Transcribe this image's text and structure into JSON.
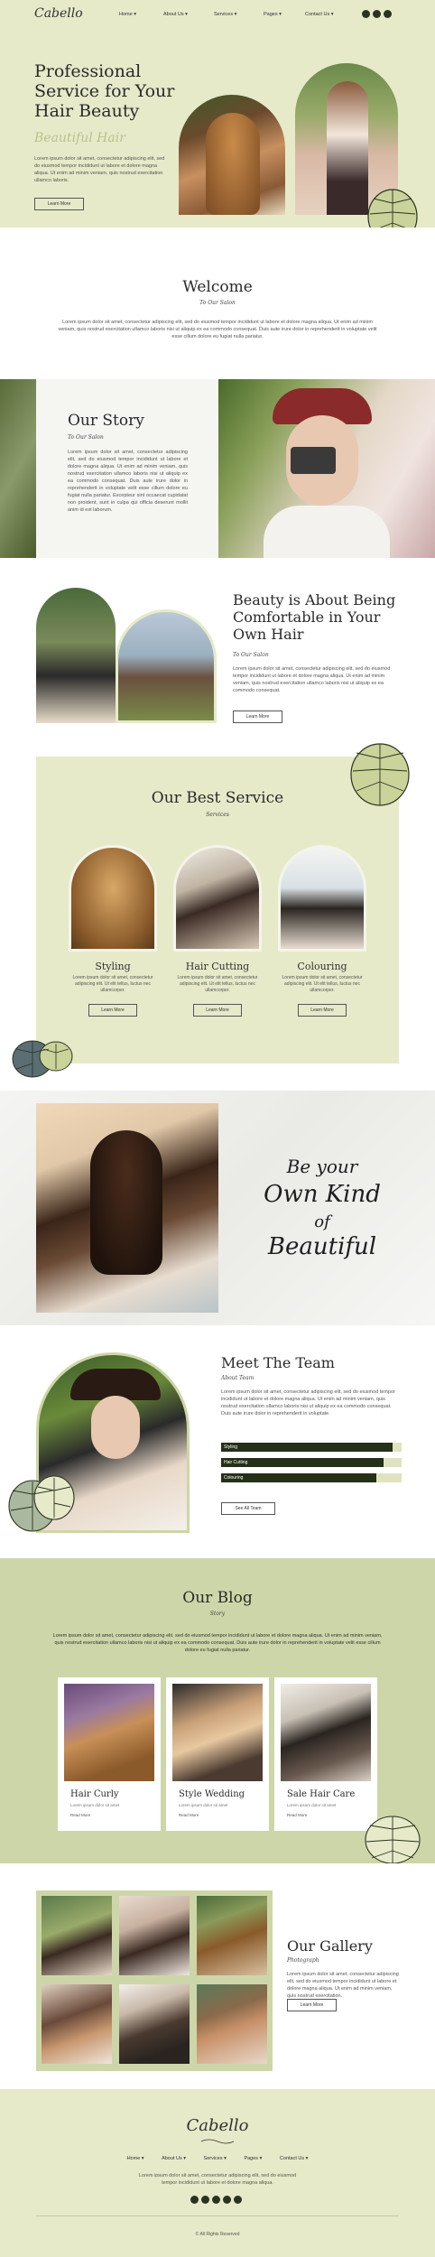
{
  "header": {
    "logo": "Cabello",
    "nav": [
      "Home",
      "About Us",
      "Services",
      "Pages",
      "Contact Us"
    ]
  },
  "hero": {
    "title_line1": "Professional",
    "title_line2": "Service for Your",
    "title_line3": "Hair Beauty",
    "subtitle": "Beautiful Hair",
    "body": "Lorem ipsum dolor sit amet, consectetur adipiscing elit, sed do eiusmod tempor incididunt ut labore et dolore magna aliqua. Ut enim ad minim veniam, quis nostrud exercitation ullamco laboris.",
    "button": "Learn More"
  },
  "welcome": {
    "title": "Welcome",
    "subtitle": "To Our Salon",
    "body": "Lorem ipsum dolor sit amet, consectetur adipiscing elit, sed do eiusmod tempor incididunt ut labore et dolore magna aliqua. Ut enim ad minim veniam, quis nostrud exercitation ullamco laboris nisi ut aliquip ex ea commodo consequat. Duis aute irure dolor in reprehenderit in voluptate velit esse cillum dolore eu fugiat nulla pariatur."
  },
  "story": {
    "title": "Our Story",
    "subtitle": "To Our Salon",
    "body": "Lorem ipsum dolor sit amet, consectetur adipiscing elit, sed do eiusmod tempor incididunt ut labore et dolore magna aliqua. Ut enim ad minim veniam, quis nostrud exercitation ullamco laboris nisi ut aliquip ex ea commodo consequat. Duis aute irure dolor in reprehenderit in voluptate velit esse cillum dolore eu fugiat nulla pariatur. Excepteur sint occaecat cupidatat non proident, sunt in culpa qui officia deserunt mollit anim id est laborum."
  },
  "beauty": {
    "title_line1": "Beauty is About Being",
    "title_line2": "Comfortable in Your",
    "title_line3": "Own Hair",
    "subtitle": "To Our Salon",
    "body": "Lorem ipsum dolor sit amet, consectetur adipiscing elit, sed do eiusmod tempor incididunt ut labore et dolore magna aliqua. Ut enim ad minim veniam, quis nostrud exercitation ullamco laboris nisi ut aliquip ex ea commodo consequat.",
    "button": "Learn More"
  },
  "services": {
    "title": "Our Best Service",
    "subtitle": "Services",
    "items": [
      {
        "name": "Styling",
        "body": "Lorem ipsum dolor sit amet, consectetur adipiscing elit. Ut elit tellus, luctus nec ullamcorper.",
        "button": "Learn More"
      },
      {
        "name": "Hair Cutting",
        "body": "Lorem ipsum dolor sit amet, consectetur adipiscing elit. Ut elit tellus, luctus nec ullamcorper.",
        "button": "Learn More"
      },
      {
        "name": "Colouring",
        "body": "Lorem ipsum dolor sit amet, consectetur adipiscing elit. Ut elit tellus, luctus nec ullamcorper.",
        "button": "Learn More"
      }
    ]
  },
  "quote": {
    "line1": "Be your",
    "line2": "Own Kind",
    "line3": "of",
    "line4": "Beautiful"
  },
  "team": {
    "title": "Meet The Team",
    "subtitle": "About Team",
    "body": "Lorem ipsum dolor sit amet, consectetur adipiscing elit, sed do eiusmod tempor incididunt ut labore et dolore magna aliqua. Ut enim ad minim veniam, quis nostrud exercitation ullamco laboris nisi ut aliquip ex ea commodo consequat. Duis aute irure dolor in reprehenderit in voluptate.",
    "skills": [
      {
        "label": "Styling",
        "percent": 95
      },
      {
        "label": "Hair Cutting",
        "percent": 90
      },
      {
        "label": "Colouring",
        "percent": 86
      }
    ],
    "button": "See All Team"
  },
  "blog": {
    "title": "Our Blog",
    "subtitle": "Story",
    "body": "Lorem ipsum dolor sit amet, consectetur adipiscing elit, sed do eiusmod tempor incididunt ut labore et dolore magna aliqua. Ut enim ad minim veniam, quis nostrud exercitation ullamco laboris nisi ut aliquip ex ea commodo consequat. Duis aute irure dolor in reprehenderit in voluptate velit esse cillum dolore eu fugiat nulla pariatur.",
    "posts": [
      {
        "title": "Hair Curly",
        "meta": "Lorem ipsum dolor sit amet",
        "link": "Read More"
      },
      {
        "title": "Style Wedding",
        "meta": "Lorem ipsum dolor sit amet",
        "link": "Read More"
      },
      {
        "title": "Sale Hair Care",
        "meta": "Lorem ipsum dolor sit amet",
        "link": "Read More"
      }
    ]
  },
  "gallery": {
    "title": "Our Gallery",
    "subtitle": "Photograph",
    "body": "Lorem ipsum dolor sit amet, consectetur adipiscing elit, sed do eiusmod tempor incididunt ut labore et dolore magna aliqua. Ut enim ad minim veniam, quis nostrud exercitation.",
    "button": "Learn More"
  },
  "footer": {
    "logo": "Cabello",
    "nav": [
      "Home",
      "About Us",
      "Services",
      "Pages",
      "Contact Us"
    ],
    "body": "Lorem ipsum dolor sit amet, consectetur adipiscing elit, sed do eiusmod tempor incididunt ut labore et dolore magna aliqua.",
    "copyright": "© All Rights Reserved"
  },
  "colors": {
    "sage": "#e5e9c8",
    "sage_dark": "#cdd6a8",
    "dark": "#243018"
  }
}
